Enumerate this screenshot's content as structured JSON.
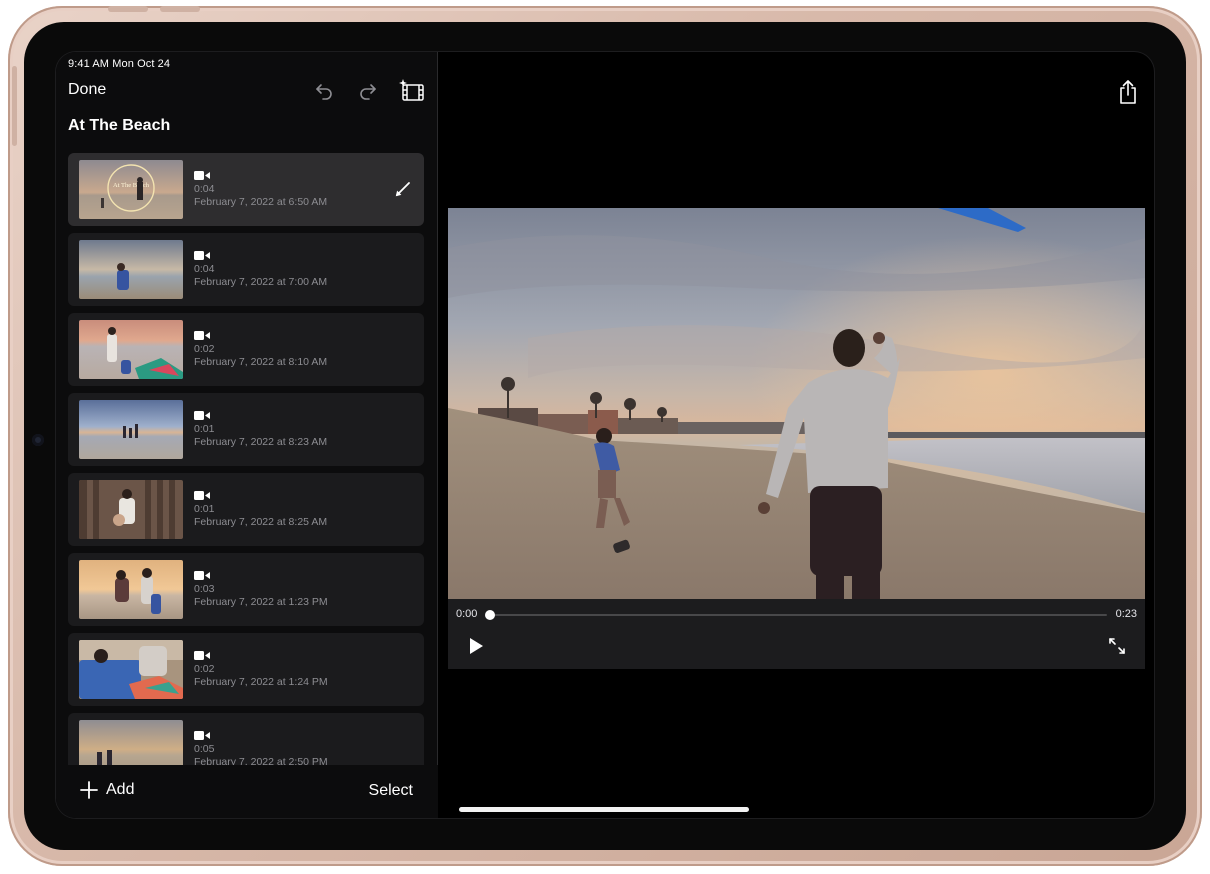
{
  "status_bar": {
    "time": "9:41 AM  Mon Oct 24"
  },
  "sidebar": {
    "done_label": "Done",
    "project_title": "At The Beach",
    "toolbar_icons": [
      "undo-icon",
      "redo-icon",
      "magic-movie-icon"
    ],
    "clips": [
      {
        "duration": "0:04",
        "date": "February 7, 2022 at 6:50 AM",
        "selected": true,
        "thumb_title": "At The Beach"
      },
      {
        "duration": "0:04",
        "date": "February 7, 2022 at 7:00 AM"
      },
      {
        "duration": "0:02",
        "date": "February 7, 2022 at 8:10 AM"
      },
      {
        "duration": "0:01",
        "date": "February 7, 2022 at 8:23 AM"
      },
      {
        "duration": "0:01",
        "date": "February 7, 2022 at 8:25 AM"
      },
      {
        "duration": "0:03",
        "date": "February 7, 2022 at 1:23 PM"
      },
      {
        "duration": "0:02",
        "date": "February 7, 2022 at 1:24 PM"
      },
      {
        "duration": "0:05",
        "date": "February 7, 2022 at 2:50 PM"
      }
    ],
    "add_label": "Add",
    "select_label": "Select"
  },
  "player": {
    "time_current": "0:00",
    "time_total": "0:23",
    "progress": 0.0
  },
  "icons": {
    "share": "share-icon",
    "play": "play-icon",
    "fullscreen": "fullscreen-icon",
    "edit": "pencil-icon",
    "video_clip": "video-camera-icon"
  },
  "colors": {
    "screen_bg": "#000000",
    "sidebar_bg": "#0c0c0d",
    "clip_bg": "#1b1b1d",
    "clip_selected_bg": "#2e2d2f",
    "secondary_text": "#8d8d92",
    "device_frame": "#d8b9aa"
  }
}
